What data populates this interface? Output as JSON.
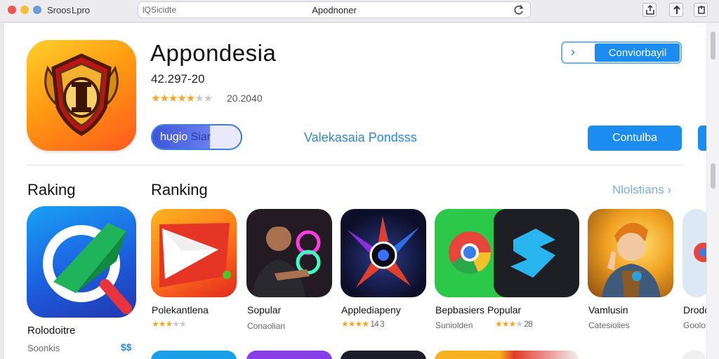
{
  "window": {
    "app_name": "Sroos",
    "menu_item": "Lpro",
    "search_hint": "lQSicidte",
    "address": "Apodnoner"
  },
  "hero": {
    "title": "Appondesia",
    "meta": "42.297-20",
    "stars": "★★★★★",
    "stars_dim": "★★",
    "rating_text": "20.2040",
    "pill_label_a": "hugio",
    "pill_label_b": "Siar",
    "developer_link": "Valekasaia Pondsss",
    "get_button": "Conviorbayil",
    "primary_button": "Contulba",
    "accent_color": "#1d8cf0"
  },
  "section": {
    "left_title": "Raking",
    "main_title": "Ranking",
    "see_all": "Nlolstians ›"
  },
  "featured": {
    "title": "Rolodoitre",
    "subtitle": "Soonkis",
    "price": "$$"
  },
  "apps": [
    {
      "name": "Polekantlena",
      "stars": "★★★",
      "stars_dim": "★★",
      "sub": ""
    },
    {
      "name": "Sopular",
      "stars": "",
      "stars_dim": "",
      "sub": "Conaolian"
    },
    {
      "name": "Applediapeny",
      "stars": "★★★★",
      "stars_dim": "",
      "sub": "14 3"
    },
    {
      "name": "Bepbasiers",
      "stars": "",
      "stars_dim": "",
      "sub": "Suniolden"
    },
    {
      "name": "Popular",
      "stars": "★★★",
      "stars_dim": "★",
      "sub": "28"
    },
    {
      "name": "Vamlusin",
      "stars": "",
      "stars_dim": "",
      "sub": "Catesiolies"
    },
    {
      "name": "Drodo",
      "stars": "",
      "stars_dim": "",
      "sub": "Goolo"
    }
  ]
}
